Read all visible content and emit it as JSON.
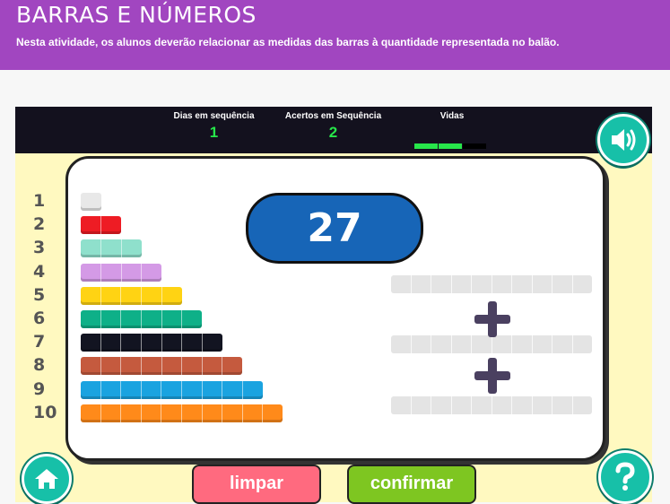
{
  "header": {
    "title": "BARRAS E NÚMEROS",
    "description": "Nesta atividade, os alunos deverão relacionar as medidas das barras à quantidade representada no balão."
  },
  "topbar": {
    "streak_label": "Dias em sequência",
    "streak_value": "1",
    "hits_label": "Acertos em Sequência",
    "hits_value": "2",
    "lives_label": "Vidas",
    "lives": {
      "total": 3,
      "remaining": 2
    }
  },
  "icons": {
    "sound": "speaker-icon",
    "home": "home-icon",
    "help": "question-icon"
  },
  "target_number": "27",
  "bars": [
    {
      "label": "1",
      "length": 1,
      "color": "#e8e8e8"
    },
    {
      "label": "2",
      "length": 2,
      "color": "#ee1c24"
    },
    {
      "label": "3",
      "length": 3,
      "color": "#8fe0cc"
    },
    {
      "label": "4",
      "length": 4,
      "color": "#d49ae6"
    },
    {
      "label": "5",
      "length": 5,
      "color": "#ffd313"
    },
    {
      "label": "6",
      "length": 6,
      "color": "#0eb088"
    },
    {
      "label": "7",
      "length": 7,
      "color": "#121421"
    },
    {
      "label": "8",
      "length": 8,
      "color": "#c55a3e"
    },
    {
      "label": "9",
      "length": 9,
      "color": "#1aa3e0"
    },
    {
      "label": "10",
      "length": 10,
      "color": "#ff8a1a"
    }
  ],
  "answer_slots": 3,
  "buttons": {
    "clear": "limpar",
    "confirm": "confirmar"
  },
  "colors": {
    "brand": "#a146c0",
    "game_bg": "#fff9c0",
    "pill": "#1765b7",
    "clear": "#ff6a7f",
    "confirm": "#7ec621"
  }
}
